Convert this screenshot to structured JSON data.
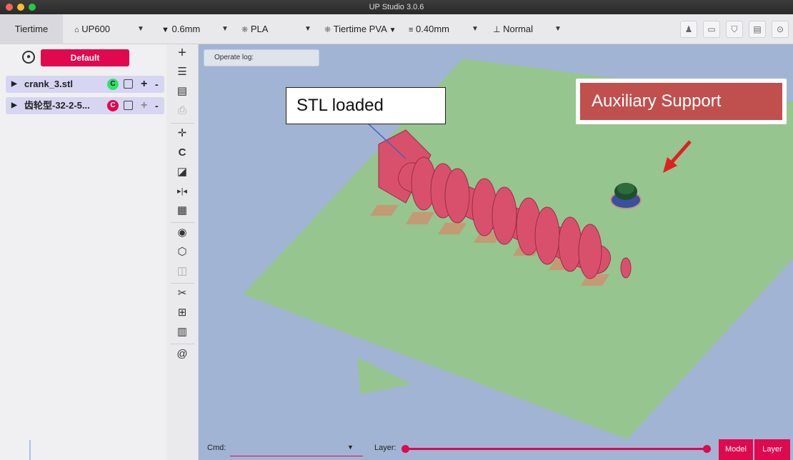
{
  "window": {
    "title": "UP Studio 3.0.6"
  },
  "toolbar": {
    "brand": "Tiertime",
    "printer": "UP600",
    "nozzle": "0.6mm",
    "material": "PLA",
    "support_material": "Tiertime PVA",
    "layer_height": "0.40mm",
    "quality": "Normal",
    "right_icons": [
      "user-icon",
      "printer-icon",
      "shirt-icon",
      "document-icon",
      "settings-icon"
    ]
  },
  "left_panel": {
    "profile_button": "Default",
    "models": [
      {
        "name": "crank_3.stl",
        "badge": "C"
      },
      {
        "name": "齿轮型-32-2-5...",
        "badge": "C"
      }
    ]
  },
  "tools": [
    "add-icon",
    "database-icon",
    "search-doc-icon",
    "print-icon",
    "move-icon",
    "rotate-icon",
    "scale-icon",
    "mirror-icon",
    "layout-icon",
    "view-icon",
    "cube-icon",
    "speaker-icon",
    "repair-icon",
    "grid-icon",
    "column-icon",
    "at-icon"
  ],
  "viewport": {
    "operate_log_label": "Operate log:",
    "callout_stl": "STL loaded",
    "callout_support": "Auxiliary Support"
  },
  "bottom": {
    "cmd_label": "Cmd:",
    "layer_label": "Layer:",
    "model_button": "Model",
    "layer_button": "Layer"
  },
  "colors": {
    "accent": "#e0084f",
    "viewport_bg": "#a1b4d4",
    "build_plate": "#96c58f",
    "model": "#d9506d",
    "support_callout": "#c0504d"
  }
}
